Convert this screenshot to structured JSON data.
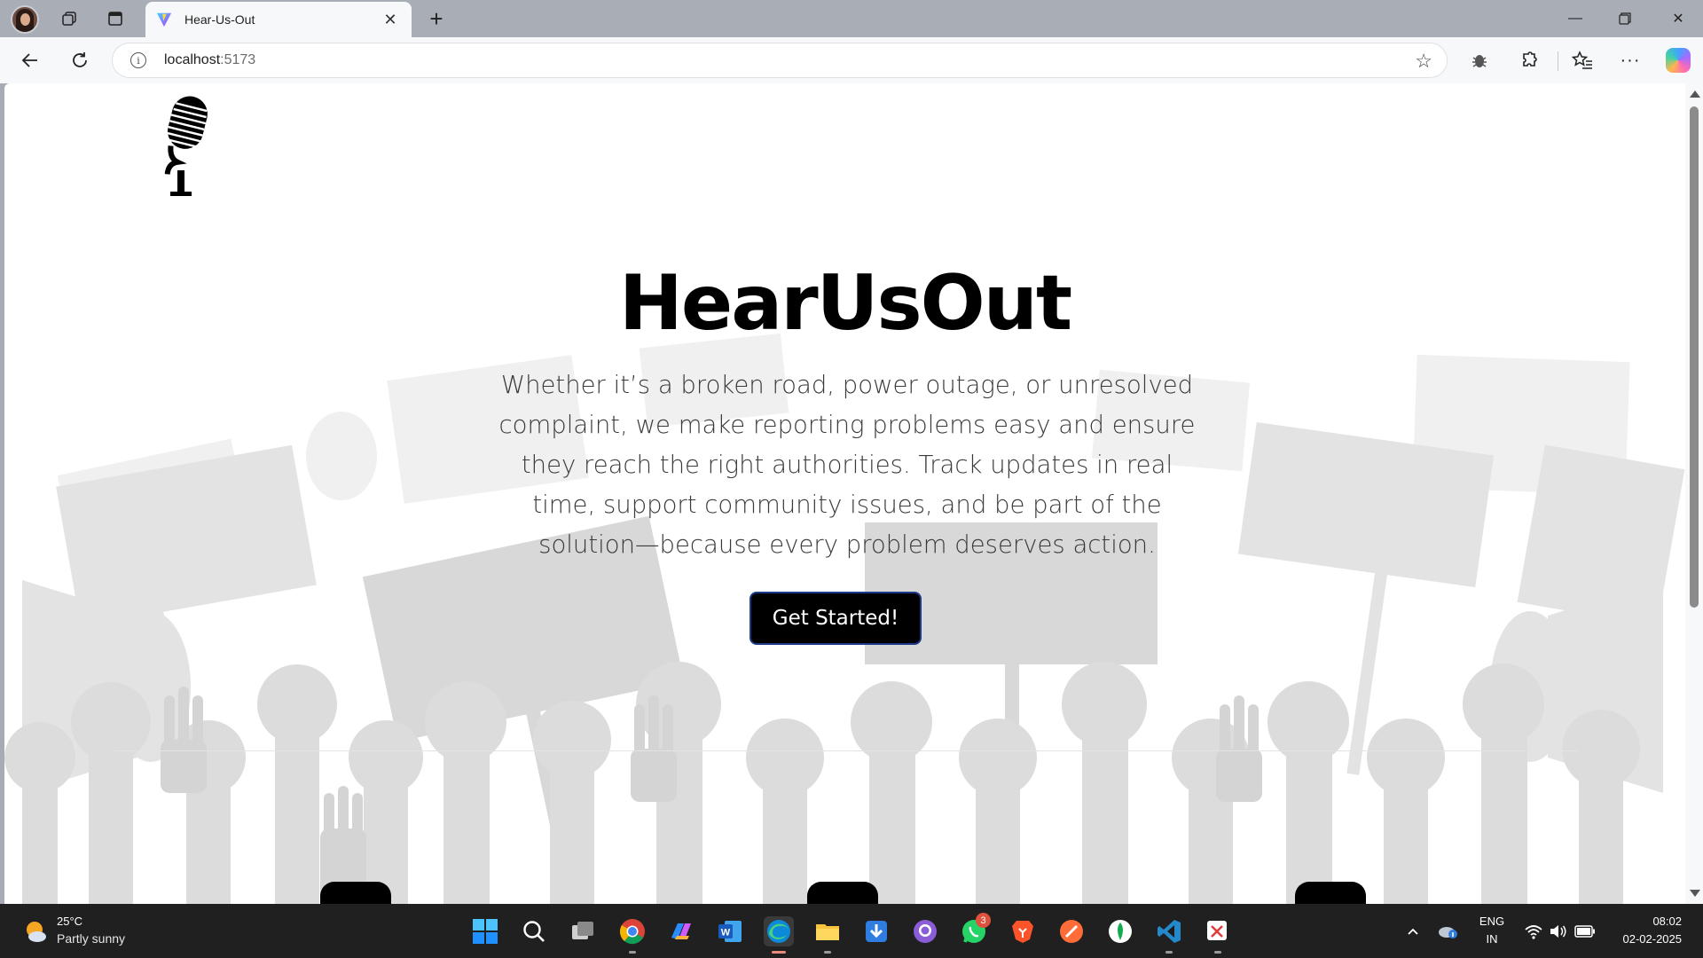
{
  "browser": {
    "tab_title": "Hear-Us-Out",
    "url_host": "localhost",
    "url_port": ":5173"
  },
  "page": {
    "title": "HearUsOut",
    "description": "Whether it’s a broken road, power outage, or unresolved complaint, we make reporting problems easy and ensure they reach the right authorities. Track updates in real time, support community issues, and be part of the solution—because every problem deserves action.",
    "cta_label": "Get Started!"
  },
  "taskbar": {
    "weather_temp": "25°C",
    "weather_condition": "Partly sunny",
    "whatsapp_badge": "3",
    "language": "ENG",
    "region": "IN",
    "time": "08:02",
    "date": "02-02-2025"
  },
  "icons": {
    "profile": "profile-avatar-icon",
    "workspaces": "workspaces-icon",
    "tab_actions": "tab-actions-icon",
    "back": "back-arrow-icon",
    "reload": "reload-icon",
    "info": "site-info-icon",
    "favorite": "star-icon",
    "extension_bug": "bug-extension-icon",
    "extensions": "puzzle-icon",
    "favorites": "favorites-icon",
    "more": "more-icon",
    "copilot": "copilot-icon",
    "logo": "microphone-icon"
  }
}
